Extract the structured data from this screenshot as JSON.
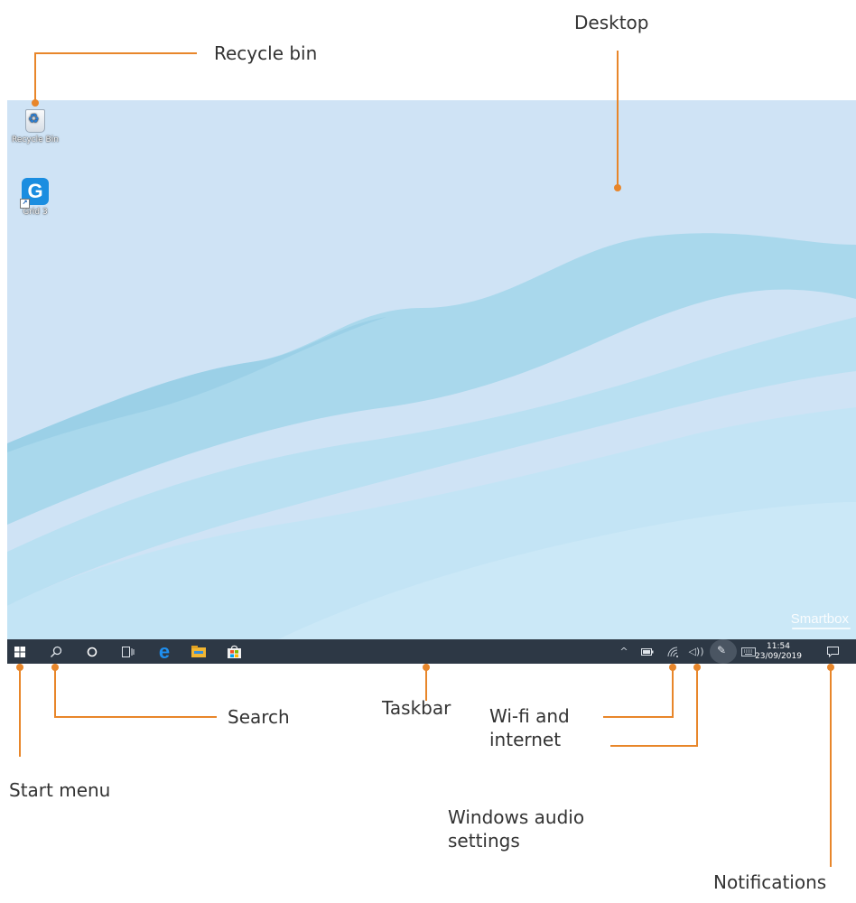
{
  "annotations": {
    "desktop": "Desktop",
    "recycle_bin": "Recycle bin",
    "search": "Search",
    "taskbar": "Taskbar",
    "wifi": [
      "Wi-fi and",
      "internet"
    ],
    "start_menu": "Start menu",
    "audio": [
      "Windows audio",
      "settings"
    ],
    "notifications": "Notifications"
  },
  "desktop_icons": [
    {
      "label": "Recycle Bin",
      "icon": "recycle-bin-icon"
    },
    {
      "label": "Grid 3",
      "icon": "grid-3-app-icon",
      "glyph": "G"
    }
  ],
  "brand": "Smartbox",
  "taskbar": {
    "clock": {
      "time": "11:54",
      "date": "23/09/2019"
    },
    "pinned": [
      "start-icon",
      "search-icon",
      "cortana-icon",
      "task-view-icon",
      "edge-icon",
      "file-explorer-icon",
      "store-icon"
    ],
    "tray": [
      "show-hidden-icons",
      "battery-icon",
      "wifi-icon",
      "volume-icon",
      "pen-icon",
      "keyboard-icon",
      "notifications-icon"
    ]
  },
  "colors": {
    "accent_annotation": "#e8862a",
    "desktop_bg": "#cfe3f5",
    "taskbar_bg": "#2d3845"
  }
}
